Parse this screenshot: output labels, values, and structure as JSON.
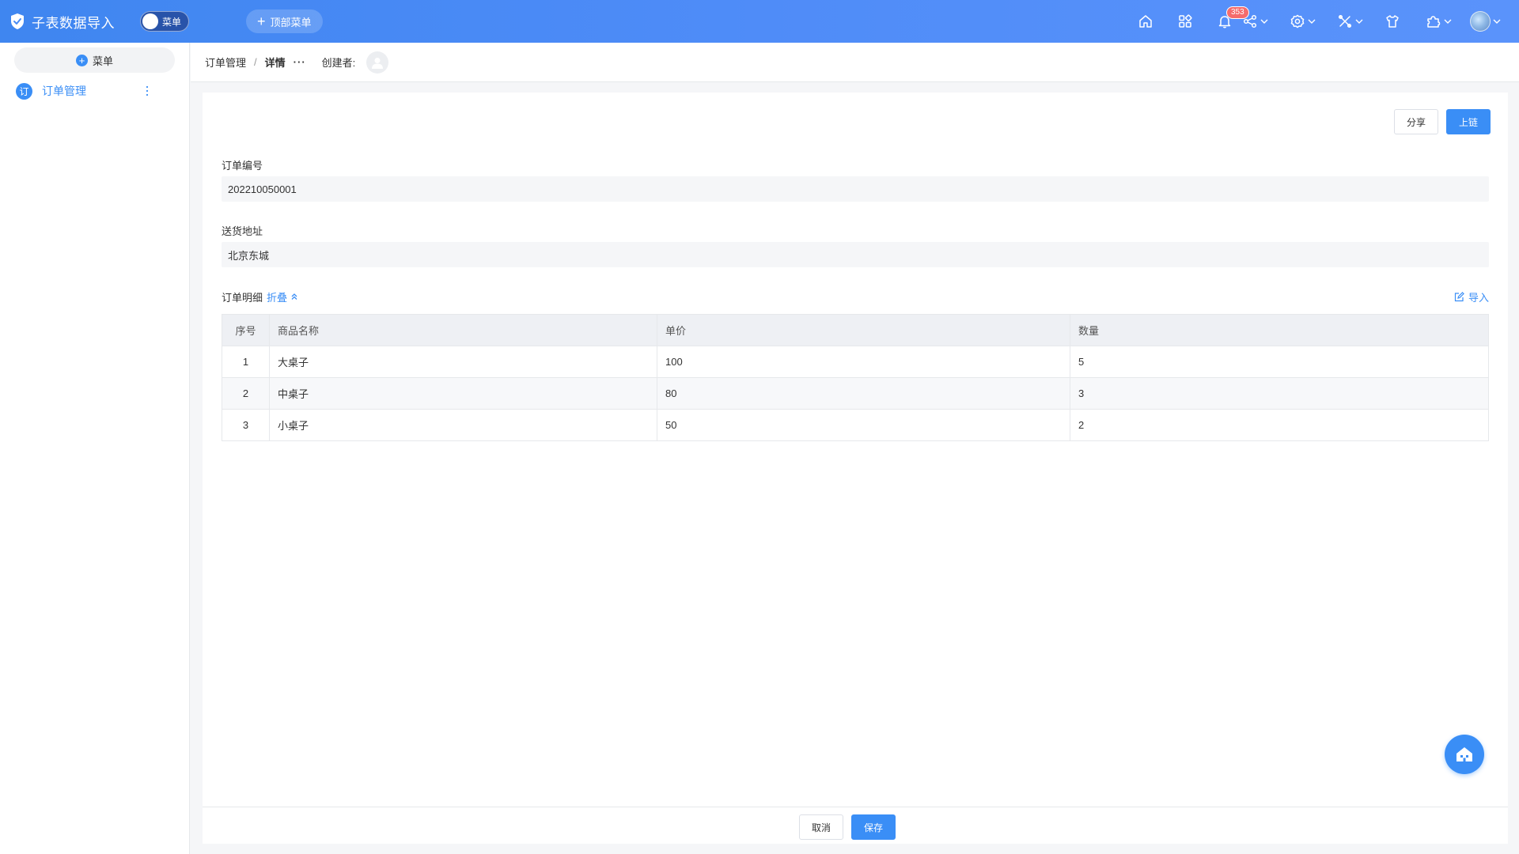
{
  "app": {
    "title": "子表数据导入",
    "menu_toggle_label": "菜单",
    "top_menu_label": "顶部菜单",
    "notification_count": "353"
  },
  "sidebar": {
    "add_menu_label": "菜单",
    "items": [
      {
        "icon_text": "订",
        "label": "订单管理"
      }
    ]
  },
  "breadcrumb": {
    "parent": "订单管理",
    "separator": "/",
    "current": "详情",
    "more": "···",
    "creator_label": "创建者:"
  },
  "actions": {
    "share_label": "分享",
    "publish_label": "上链",
    "cancel_label": "取消",
    "save_label": "保存"
  },
  "form": {
    "order_no_label": "订单编号",
    "order_no_value": "202210050001",
    "address_label": "送货地址",
    "address_value": "北京东城"
  },
  "details": {
    "title": "订单明细",
    "collapse_label": "折叠",
    "import_label": "导入",
    "columns": [
      "序号",
      "商品名称",
      "单价",
      "数量"
    ],
    "rows": [
      [
        "1",
        "大桌子",
        "100",
        "5"
      ],
      [
        "2",
        "中桌子",
        "80",
        "3"
      ],
      [
        "3",
        "小桌子",
        "50",
        "2"
      ]
    ]
  },
  "colors": {
    "accent": "#3a8ef6",
    "topbar_start": "#3f86f0",
    "topbar_end": "#5a93fb",
    "badge": "#f56c6c"
  },
  "icons": [
    "shield-icon",
    "home-icon",
    "apps-icon",
    "bell-icon",
    "share-icon",
    "gear-icon",
    "tools-icon",
    "shirt-icon",
    "puzzle-icon",
    "avatar",
    "edit-icon",
    "chevron-up-icon",
    "floating-home-icon"
  ]
}
